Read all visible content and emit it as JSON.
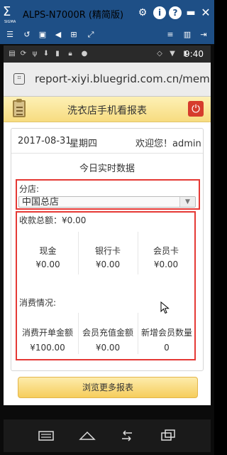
{
  "emulator": {
    "logo": "Σ",
    "logo_sub": "SIGMA",
    "title": "ALPS-N7000R (精简版)",
    "icons": [
      "gear-icon",
      "info-icon",
      "help-icon",
      "minimize-icon",
      "close-icon"
    ],
    "info_glyph": "i",
    "help_glyph": "?",
    "toolbar_icons": [
      "menu-icon",
      "refresh-icon",
      "screenshot-icon",
      "volume-icon",
      "grid-icon",
      "fullscreen-icon",
      "list-icon",
      "sidebar-icon",
      "exit-icon"
    ]
  },
  "status_bar": {
    "time": "9:40"
  },
  "url_bar": {
    "url": "report-xiyi.bluegrid.com.cn/members"
  },
  "header": {
    "title": "洗衣店手机看报表",
    "power_glyph": "⏻"
  },
  "info": {
    "date": "2017-08-31",
    "weekday": "星期四",
    "greeting": "欢迎您！admin"
  },
  "realtime_title": "今日实时数据",
  "branch": {
    "label": "分店:",
    "selected": "中国总店",
    "arrow": "▼"
  },
  "collection": {
    "total_label": "收款总额：¥0.00",
    "items": [
      {
        "label": "现金",
        "value": "¥0.00"
      },
      {
        "label": "银行卡",
        "value": "¥0.00"
      },
      {
        "label": "会员卡",
        "value": "¥0.00"
      }
    ]
  },
  "consumption": {
    "title": "消费情况:",
    "items": [
      {
        "label": "消费开单金额",
        "value": "¥100.00"
      },
      {
        "label": "会员充值金额",
        "value": "¥0.00"
      },
      {
        "label": "新增会员数量",
        "value": "0"
      }
    ]
  },
  "more_button": "浏览更多报表",
  "accent": {
    "header_yellow": "#f7dc80",
    "highlight_red": "#e53935",
    "title_blue": "#1e4f86"
  }
}
